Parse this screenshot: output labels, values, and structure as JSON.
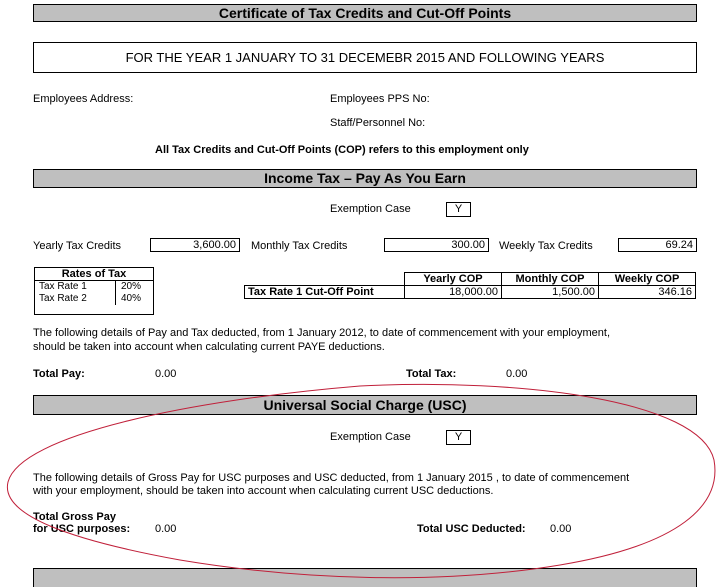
{
  "certificate": {
    "title": "Certificate of Tax Credits and Cut-Off Points",
    "year_banner": "FOR THE YEAR 1 JANUARY TO 31 DECEMEBR 2015 AND FOLLOWING YEARS",
    "employees_address_label": "Employees Address:",
    "pps_label": "Employees PPS No:",
    "staff_label": "Staff/Personnel No:",
    "note": "All Tax Credits and Cut-Off Points (COP) refers to this employment only"
  },
  "paye": {
    "heading": "Income Tax – Pay As You Earn",
    "exemption_label": "Exemption Case",
    "exemption_value": "Y",
    "yearly_label": "Yearly Tax Credits",
    "yearly_value": "3,600.00",
    "monthly_label": "Monthly Tax Credits",
    "monthly_value": "300.00",
    "weekly_label": "Weekly Tax Credits",
    "weekly_value": "69.24",
    "rates": {
      "title": "Rates of Tax",
      "rows": [
        {
          "label": "Tax Rate 1",
          "value": "20%"
        },
        {
          "label": "Tax Rate 2",
          "value": "40%"
        }
      ]
    },
    "cop_table": {
      "headers": [
        "Yearly COP",
        "Monthly COP",
        "Weekly COP"
      ],
      "row_label": "Tax Rate 1 Cut-Off Point",
      "values": [
        "18,000.00",
        "1,500.00",
        "346.16"
      ]
    },
    "details_line1": "The following details of Pay and Tax deducted, from 1 January 2012, to date of commencement with your employment,",
    "details_line2": "should be taken into account when calculating current PAYE deductions.",
    "total_pay_label": "Total Pay:",
    "total_pay_value": "0.00",
    "total_tax_label": "Total Tax:",
    "total_tax_value": "0.00"
  },
  "usc": {
    "heading": "Universal Social Charge (USC)",
    "exemption_label": "Exemption Case",
    "exemption_value": "Y",
    "details_line1": "The following details of Gross Pay for USC purposes and USC deducted, from  1 January 2015 , to date of commencement",
    "details_line2": "with your employment, should be taken into account when calculating current USC deductions.",
    "total_gross_label_1": "Total Gross Pay",
    "total_gross_label_2": "for USC purposes:",
    "total_gross_value": "0.00",
    "total_usc_label": "Total USC Deducted:",
    "total_usc_value": "0.00"
  },
  "colors": {
    "header_bar": "#bfbfbf",
    "annotation_ellipse": "#c0203a"
  }
}
